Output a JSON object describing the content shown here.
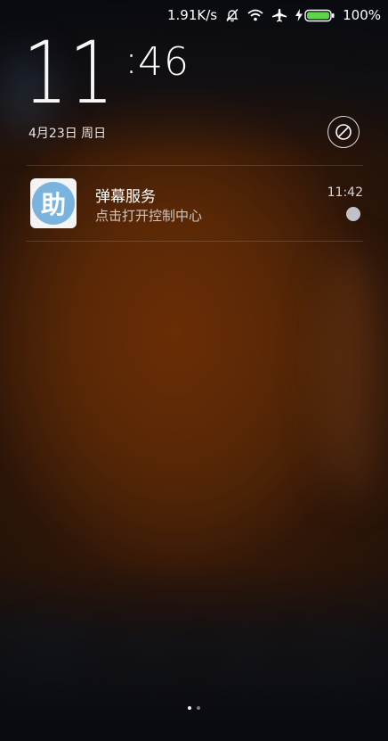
{
  "status_bar": {
    "network_speed": "1.91K/s",
    "battery_percent": "100%",
    "battery_level": 1.0,
    "icons": [
      "bell-off-icon",
      "wifi-icon",
      "airplane-icon",
      "charging-icon",
      "battery-icon"
    ]
  },
  "lockscreen": {
    "clock": {
      "hours": "11",
      "colon": ":",
      "minutes": "46"
    },
    "date": "4月23日 周日"
  },
  "notifications": [
    {
      "app_icon_char": "助",
      "app_icon_color": "#7ab3dd",
      "title": "弹幕服务",
      "body": "点击打开控制中心",
      "time": "11:42"
    }
  ],
  "page_indicator": {
    "count": 2,
    "active_index": 0
  }
}
